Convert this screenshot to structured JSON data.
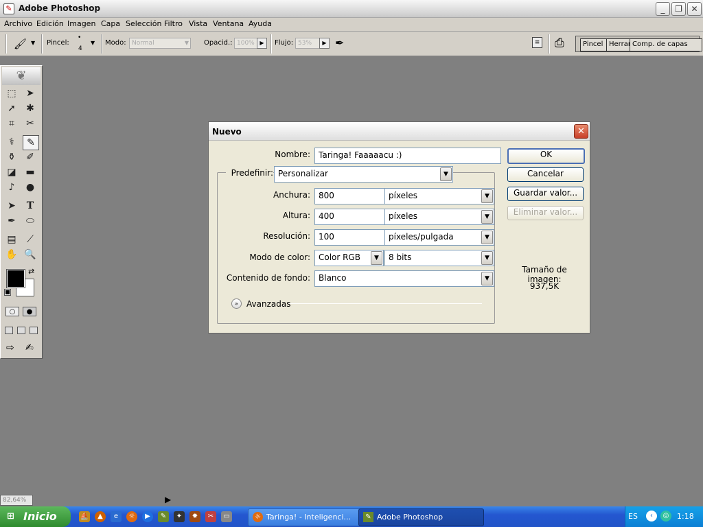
{
  "window": {
    "title": "Adobe Photoshop",
    "minimize_glyph": "_",
    "restore_glyph": "❐",
    "close_glyph": "✕"
  },
  "menu": [
    "Archivo",
    "Edición",
    "Imagen",
    "Capa",
    "Selección",
    "Filtro",
    "Vista",
    "Ventana",
    "Ayuda"
  ],
  "options_bar": {
    "brush_label": "Pincel:",
    "brush_size": "4",
    "mode_label": "Modo:",
    "mode_value": "Normal",
    "opacity_label": "Opacid.:",
    "opacity_value": "100%",
    "flow_label": "Flujo:",
    "flow_value": "53%",
    "panel_tabs": [
      "Pincel",
      "Herram",
      "Comp. de capas"
    ]
  },
  "toolbox": {
    "icons": [
      "marquee-icon",
      "move-icon",
      "lasso-icon",
      "magic-wand-icon",
      "crop-icon",
      "slice-icon",
      "healing-brush-icon",
      "brush-icon",
      "clone-stamp-icon",
      "history-brush-icon",
      "eraser-icon",
      "gradient-icon",
      "blur-icon",
      "dodge-icon",
      "path-select-icon",
      "type-icon",
      "pen-icon",
      "shape-icon",
      "notes-icon",
      "eyedropper-icon",
      "hand-icon",
      "zoom-icon"
    ],
    "selected": "brush-icon",
    "foreground_color": "#000000",
    "background_color": "#ffffff"
  },
  "dialog": {
    "title": "Nuevo",
    "name_label": "Nombre:",
    "name_value": "Taringa! Faaaaacu :)",
    "preset_label": "Predefinir:",
    "preset_value": "Personalizar",
    "width_label": "Anchura:",
    "width_value": "800",
    "width_unit": "píxeles",
    "height_label": "Altura:",
    "height_value": "400",
    "height_unit": "píxeles",
    "resolution_label": "Resolución:",
    "resolution_value": "100",
    "resolution_unit": "píxeles/pulgada",
    "color_mode_label": "Modo de color:",
    "color_mode_value": "Color RGB",
    "bit_depth_value": "8 bits",
    "background_label": "Contenido de fondo:",
    "background_value": "Blanco",
    "advanced_label": "Avanzadas",
    "buttons": {
      "ok": "OK",
      "cancel": "Cancelar",
      "save": "Guardar valor...",
      "delete": "Eliminar valor..."
    },
    "image_size_label": "Tamaño de imagen:",
    "image_size_value": "937,5K"
  },
  "status_bar": {
    "zoom": "82,64%"
  },
  "taskbar": {
    "start_label": "Inicio",
    "tasks": [
      {
        "label": "Taringa! - Inteligenci...",
        "active": false
      },
      {
        "label": "Adobe Photoshop",
        "active": true
      }
    ],
    "language": "ES",
    "clock": "1:18"
  }
}
